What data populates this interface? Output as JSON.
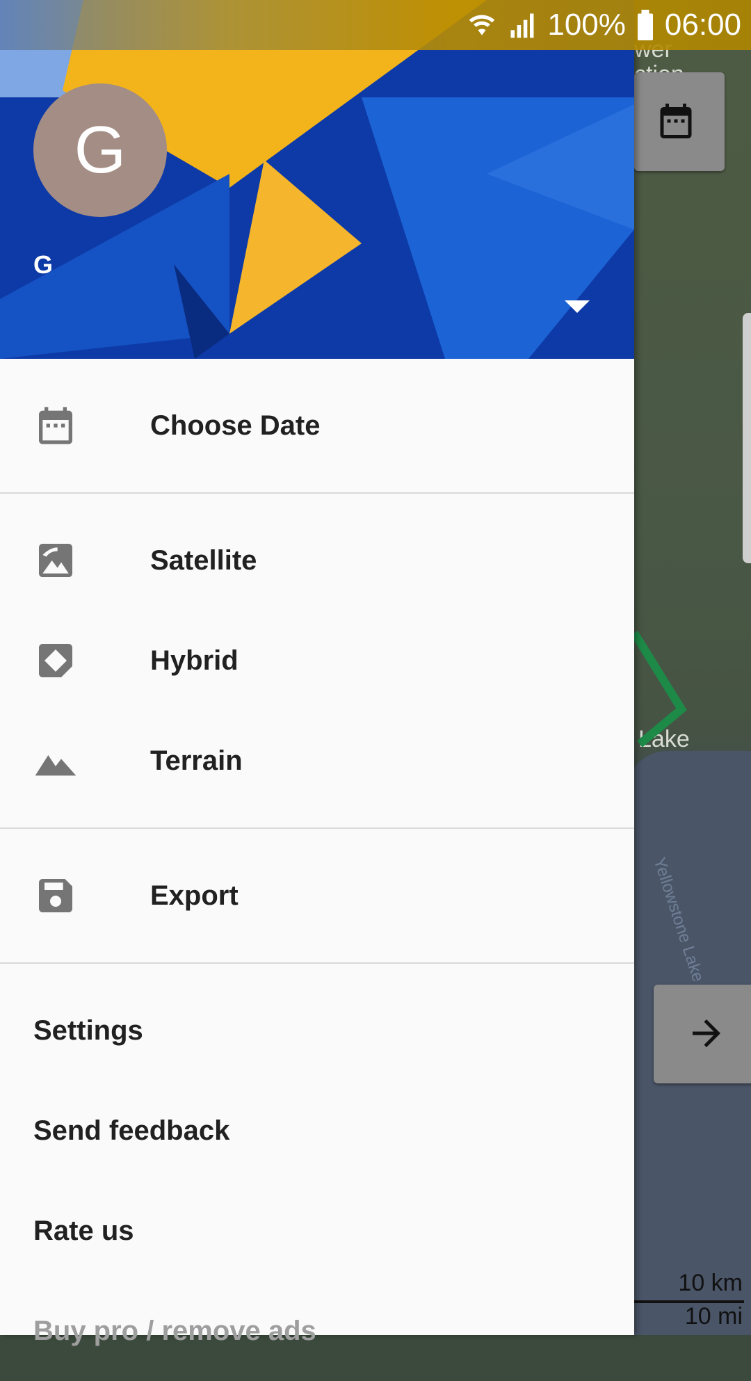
{
  "status_bar": {
    "battery": "100%",
    "time": "06:00",
    "icons": [
      "wifi-icon",
      "signal-icon",
      "battery-icon"
    ]
  },
  "map": {
    "labels": {
      "top_partial_1": "wer",
      "top_partial_2": "ction",
      "lake_town": "Lake",
      "lake_name": "Yellowstone Lake"
    },
    "scale": {
      "km": "10 km",
      "mi": "10 mi"
    },
    "fab_icons": [
      "calendar-icon",
      "arrow-right-icon"
    ]
  },
  "drawer": {
    "header": {
      "avatar_letter": "G",
      "account_name": "G"
    },
    "sections": {
      "date": {
        "label": "Choose Date",
        "icon": "calendar-icon"
      },
      "layers": [
        {
          "label": "Satellite",
          "icon": "satellite-image-icon"
        },
        {
          "label": "Hybrid",
          "icon": "hybrid-icon"
        },
        {
          "label": "Terrain",
          "icon": "terrain-icon"
        }
      ],
      "export": {
        "label": "Export",
        "icon": "save-icon"
      },
      "misc": [
        {
          "label": "Settings"
        },
        {
          "label": "Send feedback"
        },
        {
          "label": "Rate us"
        },
        {
          "label": "Buy pro / remove ads"
        }
      ]
    }
  },
  "colors": {
    "drawer_bg": "#fafafa",
    "header_blue": "#0f3fae",
    "header_yellow": "#f3b41b",
    "avatar_bg": "#a48d85",
    "route_green": "#1d8a48"
  }
}
